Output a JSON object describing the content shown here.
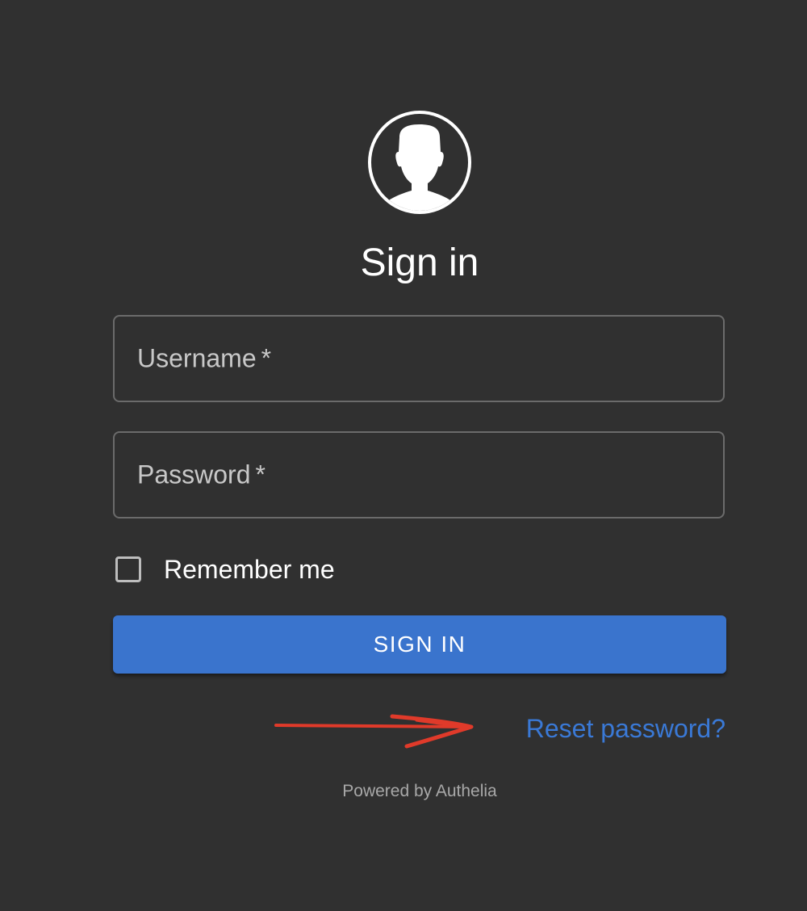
{
  "header": {
    "avatar_icon": "user-avatar-icon",
    "title": "Sign in"
  },
  "form": {
    "username": {
      "label": "Username",
      "required_mark": "*",
      "value": ""
    },
    "password": {
      "label": "Password",
      "required_mark": "*",
      "value": ""
    },
    "remember_me": {
      "label": "Remember me",
      "checked": false
    },
    "submit_label": "SIGN IN",
    "reset_link": "Reset password?"
  },
  "annotation": {
    "icon": "red-arrow-icon",
    "color": "#e03a2a"
  },
  "footer": {
    "powered_by": "Powered by Authelia"
  },
  "colors": {
    "background": "#303030",
    "primary": "#3a74cd",
    "link": "#3a79d6",
    "text": "#ffffff",
    "muted": "#a8a8a8"
  }
}
